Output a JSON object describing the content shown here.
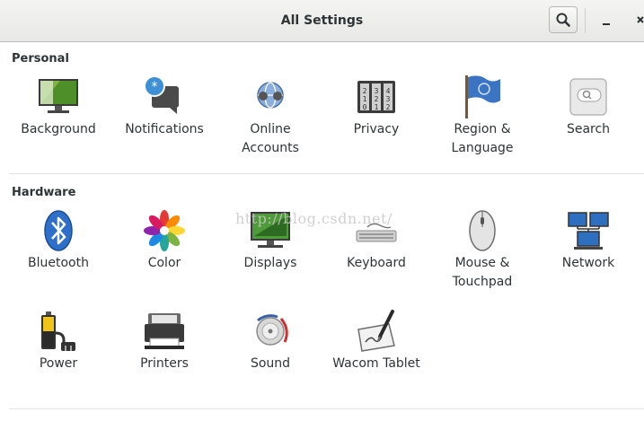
{
  "window": {
    "title": "All Settings"
  },
  "sections": {
    "personal": {
      "title": "Personal",
      "items": [
        {
          "label": "Background",
          "icon": "background-icon"
        },
        {
          "label": "Notifications",
          "icon": "notifications-icon"
        },
        {
          "label": "Online\nAccounts",
          "icon": "online-accounts-icon"
        },
        {
          "label": "Privacy",
          "icon": "privacy-icon"
        },
        {
          "label": "Region &\nLanguage",
          "icon": "region-language-icon"
        },
        {
          "label": "Search",
          "icon": "search-settings-icon"
        }
      ]
    },
    "hardware": {
      "title": "Hardware",
      "items": [
        {
          "label": "Bluetooth",
          "icon": "bluetooth-icon"
        },
        {
          "label": "Color",
          "icon": "color-icon"
        },
        {
          "label": "Displays",
          "icon": "displays-icon"
        },
        {
          "label": "Keyboard",
          "icon": "keyboard-icon"
        },
        {
          "label": "Mouse &\nTouchpad",
          "icon": "mouse-icon"
        },
        {
          "label": "Network",
          "icon": "network-icon"
        },
        {
          "label": "Power",
          "icon": "power-icon"
        },
        {
          "label": "Printers",
          "icon": "printer-icon"
        },
        {
          "label": "Sound",
          "icon": "sound-icon"
        },
        {
          "label": "Wacom Tablet",
          "icon": "wacom-tablet-icon"
        }
      ]
    }
  },
  "watermark": "http://blog.csdn.net/"
}
